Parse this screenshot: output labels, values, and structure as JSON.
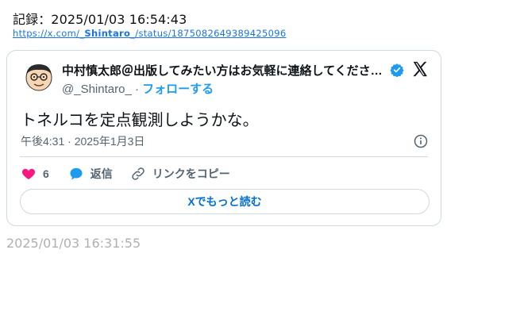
{
  "record": {
    "text": "記録：2025/01/03 16:54:43"
  },
  "link": {
    "prefix": "https://x.com/",
    "user": "_Shintaro_",
    "suffix": "/status/1875082649389425096"
  },
  "tweet": {
    "display_name": "中村慎太郎＠出版してみたい方はお気軽に連絡してくださ…",
    "handle": "@_Shintaro_",
    "separator": "·",
    "follow_label": "フォローする",
    "text": "トネルコを定点観測しようかな。",
    "time": "午後4:31 · 2025年1月3日",
    "like_count": "6",
    "reply_label": "返信",
    "copy_link_label": "リンクをコピー",
    "read_more_label": "Xでもっと読む"
  },
  "footer": {
    "timestamp": "2025/01/03 16:31:55"
  },
  "colors": {
    "accent": "#1d9bf0",
    "like": "#f91880",
    "muted": "#536471",
    "border": "#cfd9de"
  },
  "icons": [
    "avatar",
    "verified-badge-icon",
    "x-logo-icon",
    "info-icon",
    "heart-icon",
    "reply-bubble-icon",
    "link-icon"
  ]
}
